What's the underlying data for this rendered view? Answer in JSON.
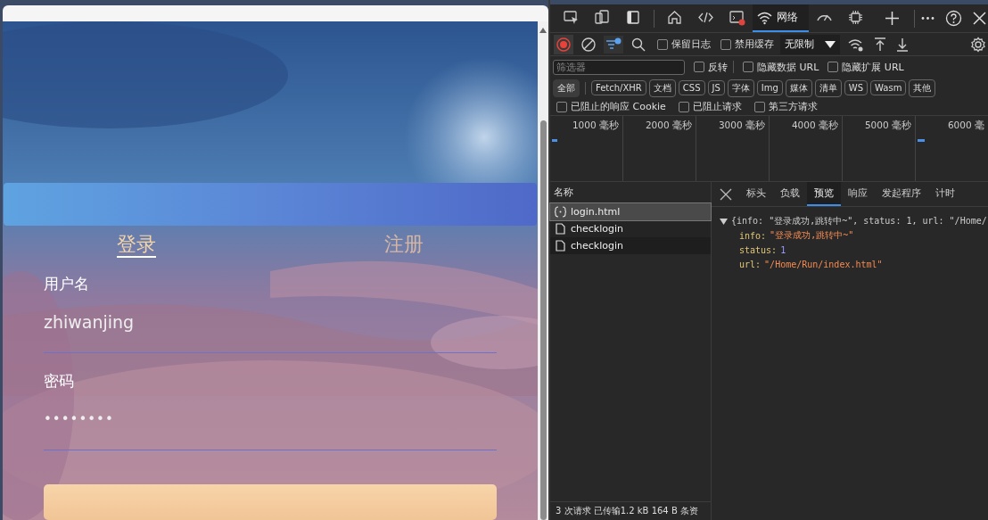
{
  "page": {
    "tabs": [
      {
        "label": "登录",
        "selected": true
      },
      {
        "label": "注册",
        "selected": false
      }
    ],
    "fields": [
      {
        "label": "用户名",
        "value": "zhiwanjing",
        "kind": "text"
      },
      {
        "label": "密码",
        "value": "••••••••",
        "kind": "password"
      }
    ]
  },
  "devtools": {
    "main_tabs": [
      {
        "selected": false
      },
      {
        "selected": false
      },
      {
        "selected": false
      },
      {
        "selected": false
      },
      {
        "selected": false
      },
      {
        "selected": false
      },
      {
        "label": "网络",
        "selected": true
      },
      {
        "selected": false
      },
      {
        "selected": false
      }
    ],
    "recording": {
      "on": true
    },
    "toolbar_checks": [
      {
        "label": "保留日志",
        "checked": false
      },
      {
        "label": "禁用缓存",
        "checked": false
      }
    ],
    "throttle": "无限制",
    "filter": {
      "placeholder": "筛选器"
    },
    "filter_checks": [
      {
        "label": "反转",
        "checked": false
      },
      {
        "label": "隐藏数据 URL",
        "checked": false
      },
      {
        "label": "隐藏扩展 URL",
        "checked": false
      }
    ],
    "types": [
      {
        "label": "全部",
        "selected": true
      },
      {
        "label": "Fetch/XHR",
        "selected": false
      },
      {
        "label": "文档",
        "selected": false
      },
      {
        "label": "CSS",
        "selected": false
      },
      {
        "label": "JS",
        "selected": false
      },
      {
        "label": "字体",
        "selected": false
      },
      {
        "label": "Img",
        "selected": false
      },
      {
        "label": "媒体",
        "selected": false
      },
      {
        "label": "清单",
        "selected": false
      },
      {
        "label": "WS",
        "selected": false
      },
      {
        "label": "Wasm",
        "selected": false
      },
      {
        "label": "其他",
        "selected": false
      }
    ],
    "blocked_checks": [
      {
        "label": "已阻止的响应 Cookie",
        "checked": false
      },
      {
        "label": "已阻止请求",
        "checked": false
      },
      {
        "label": "第三方请求",
        "checked": false
      }
    ],
    "timeline_ticks": [
      "1000 毫秒",
      "2000 毫秒",
      "3000 毫秒",
      "4000 毫秒",
      "5000 毫秒",
      "6000 毫"
    ],
    "requests": {
      "header": "名称",
      "rows": [
        {
          "name": "login.html",
          "kind": "document",
          "selected": true
        },
        {
          "name": "checklogin",
          "kind": "file",
          "selected": false
        },
        {
          "name": "checklogin",
          "kind": "file",
          "selected": false
        }
      ]
    },
    "detail_tabs": [
      {
        "label": "标头",
        "selected": false
      },
      {
        "label": "负载",
        "selected": false
      },
      {
        "label": "预览",
        "selected": true
      },
      {
        "label": "响应",
        "selected": false
      },
      {
        "label": "发起程序",
        "selected": false
      },
      {
        "label": "计时",
        "selected": false
      }
    ],
    "preview": {
      "summary": "{info: \"登录成功,跳转中~\", status: 1, url: \"/Home/",
      "expanded": true,
      "props": [
        {
          "key": "info:",
          "value": "\"登录成功,跳转中~\"",
          "kind": "string"
        },
        {
          "key": "status:",
          "value": "1",
          "kind": "number"
        },
        {
          "key": "url:",
          "value": "\"/Home/Run/index.html\"",
          "kind": "string"
        }
      ]
    },
    "status_bar": "3 次请求  已传输1.2 kB  164 B 条资"
  }
}
